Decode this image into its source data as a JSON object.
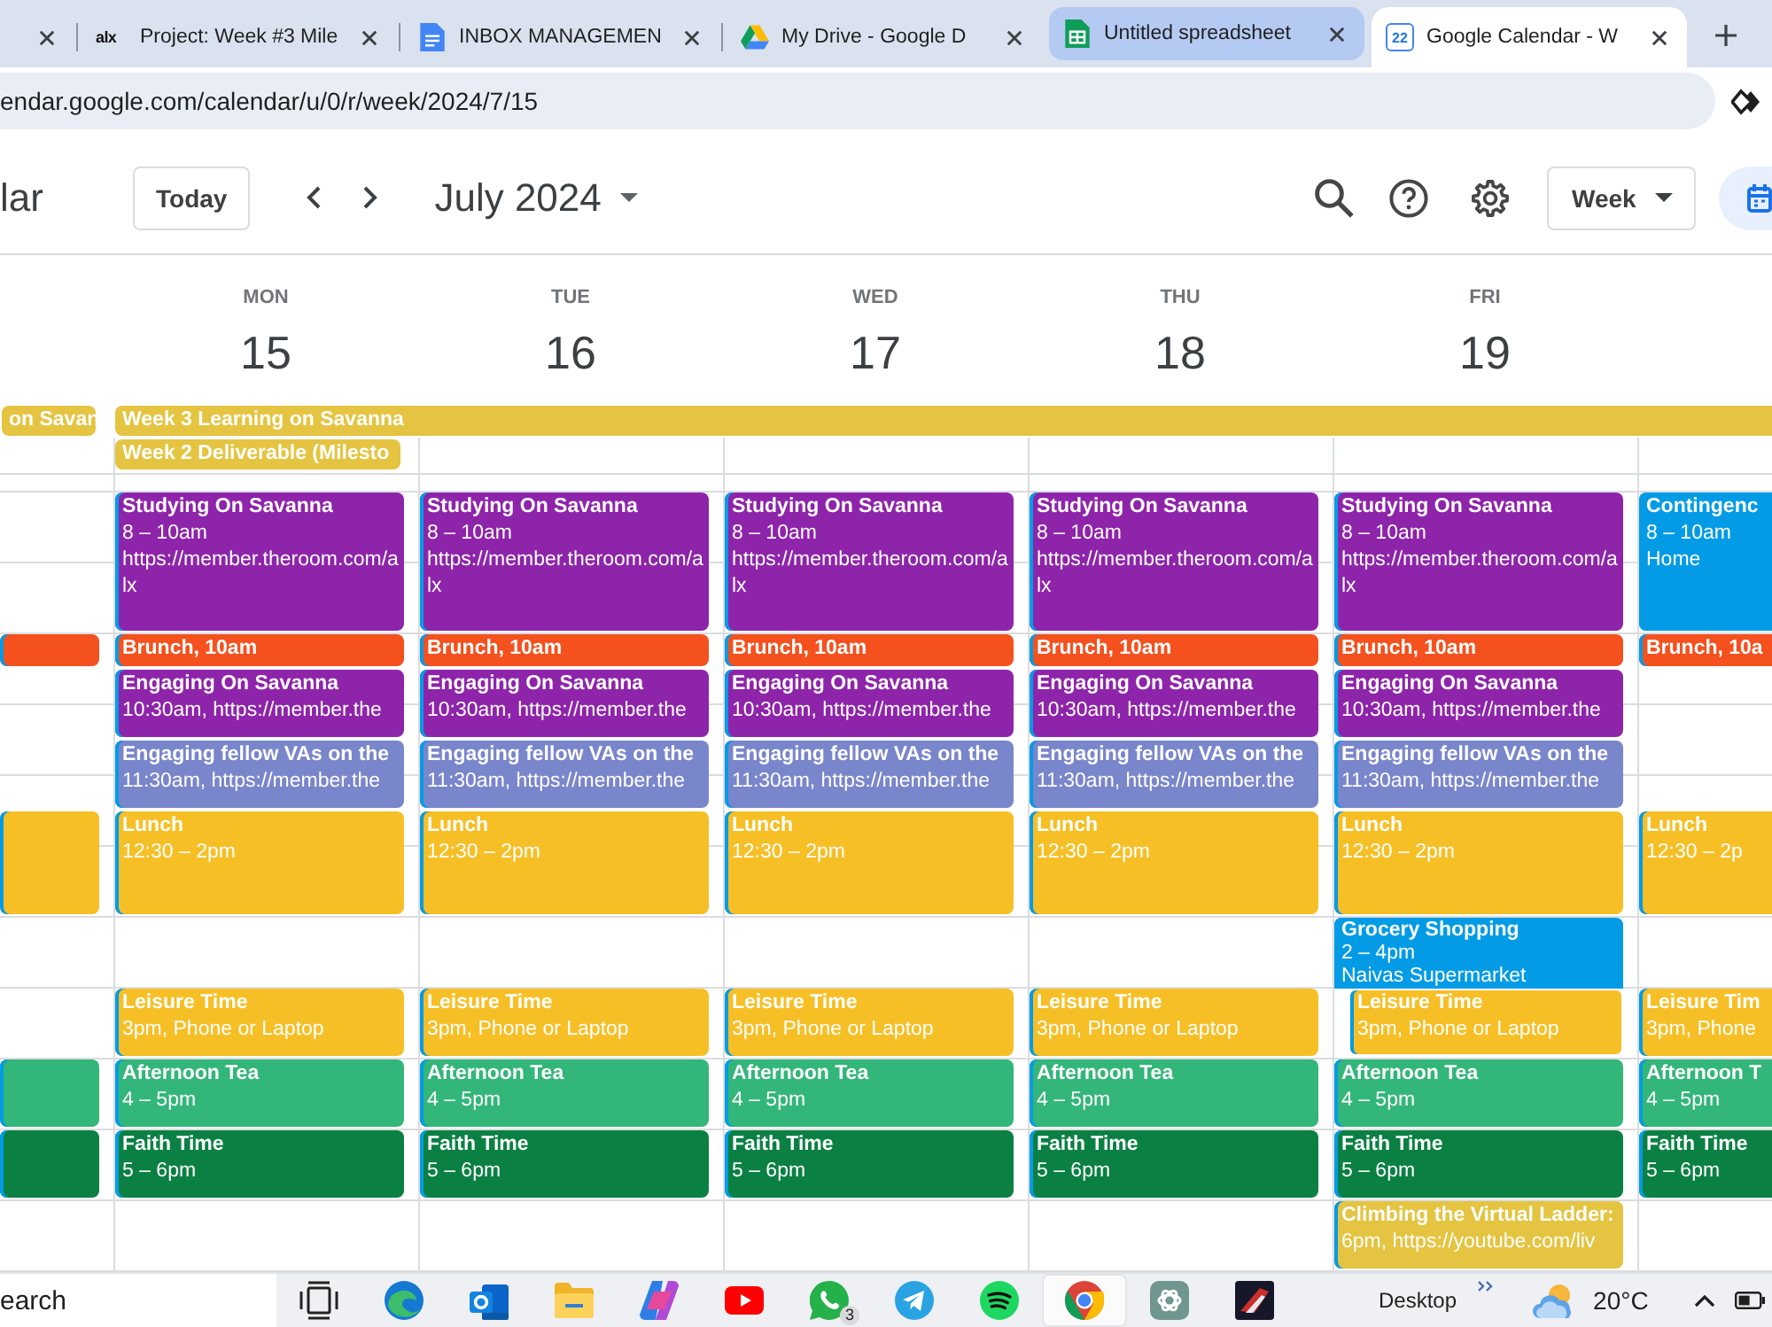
{
  "browser": {
    "tabs": [
      {
        "kind": "blank",
        "selected": false,
        "highlighted": false
      },
      {
        "kind": "alx",
        "icon_text": "alx",
        "title": "Project: Week #3 Mile",
        "selected": false,
        "highlighted": false
      },
      {
        "kind": "docs",
        "title": "INBOX MANAGEMEN",
        "selected": false,
        "highlighted": false
      },
      {
        "kind": "drive",
        "title": "My Drive - Google D",
        "selected": false,
        "highlighted": false
      },
      {
        "kind": "sheets",
        "title": "Untitled spreadsheet",
        "selected": false,
        "highlighted": true
      },
      {
        "kind": "calendar",
        "icon_text": "22",
        "title": "Google Calendar - W",
        "selected": true,
        "highlighted": false
      }
    ],
    "address_bar": {
      "url": "endar.google.com/calendar/u/0/r/week/2024/7/15"
    }
  },
  "header": {
    "app_title": "lar",
    "today_button": "Today",
    "period": "July 2024",
    "view_button": "Week"
  },
  "week": {
    "columns": [
      {
        "all_day": [
          {
            "title": "on Savan",
            "kind": "day",
            "color": "#e4c441"
          }
        ],
        "events": [
          {
            "kind": "free-double"
          },
          {
            "kind": "half",
            "color": "#f4511e"
          },
          {
            "kind": "free-double"
          },
          {
            "kind": "ninety",
            "color": "#f6bf26"
          },
          {
            "kind": "free-double"
          },
          {
            "kind": "hour",
            "color": "#33b679"
          },
          {
            "kind": "hour",
            "color": "#0b8043"
          }
        ]
      },
      {
        "weekday": "MON",
        "date": "15",
        "all_day": [
          {
            "title": "Week 3 Learning on Savanna",
            "kind": "week",
            "color": "#e4c441"
          },
          {
            "title": "Week 2 Deliverable (Milesto",
            "kind": "day",
            "color": "#e4c441"
          }
        ],
        "events": [
          {
            "kind": "double",
            "title": "Studying On Savanna",
            "lines": [
              "8 – 10am",
              "https://member.theroom.com/alx"
            ],
            "color": "#8e24aa"
          },
          {
            "kind": "half",
            "title": "Brunch, 10am",
            "color": "#f4511e"
          },
          {
            "kind": "hour",
            "title": "Engaging On Savanna",
            "lines": [
              "10:30am, https://member.the"
            ],
            "color": "#8e24aa"
          },
          {
            "kind": "hour",
            "title": "Engaging fellow VAs on the",
            "lines": [
              "11:30am, https://member.the"
            ],
            "color": "#7986cb"
          },
          {
            "kind": "ninety",
            "title": "Lunch",
            "lines": [
              "12:30 – 2pm"
            ],
            "color": "#f6bf26"
          },
          {
            "kind": "free-hour"
          },
          {
            "kind": "hour",
            "title": "Leisure Time",
            "lines": [
              "3pm, Phone or Laptop"
            ],
            "color": "#f6bf26"
          },
          {
            "kind": "hour",
            "title": "Afternoon Tea",
            "lines": [
              "4 – 5pm"
            ],
            "color": "#33b679"
          },
          {
            "kind": "hour",
            "title": "Faith Time",
            "lines": [
              "5 – 6pm"
            ],
            "color": "#0b8043"
          }
        ]
      },
      {
        "weekday": "TUE",
        "date": "16",
        "events": [
          {
            "kind": "double",
            "title": "Studying On Savanna",
            "lines": [
              "8 – 10am",
              "https://member.theroom.com/alx"
            ],
            "color": "#8e24aa"
          },
          {
            "kind": "half",
            "title": "Brunch, 10am",
            "color": "#f4511e"
          },
          {
            "kind": "hour",
            "title": "Engaging On Savanna",
            "lines": [
              "10:30am, https://member.the"
            ],
            "color": "#8e24aa"
          },
          {
            "kind": "hour",
            "title": "Engaging fellow VAs on the",
            "lines": [
              "11:30am, https://member.the"
            ],
            "color": "#7986cb"
          },
          {
            "kind": "ninety",
            "title": "Lunch",
            "lines": [
              "12:30 – 2pm"
            ],
            "color": "#f6bf26"
          },
          {
            "kind": "free-hour"
          },
          {
            "kind": "hour",
            "title": "Leisure Time",
            "lines": [
              "3pm, Phone or Laptop"
            ],
            "color": "#f6bf26"
          },
          {
            "kind": "hour",
            "title": "Afternoon Tea",
            "lines": [
              "4 – 5pm"
            ],
            "color": "#33b679"
          },
          {
            "kind": "hour",
            "title": "Faith Time",
            "lines": [
              "5 – 6pm"
            ],
            "color": "#0b8043"
          }
        ]
      },
      {
        "weekday": "WED",
        "date": "17",
        "events": [
          {
            "kind": "double",
            "title": "Studying On Savanna",
            "lines": [
              "8 – 10am",
              "https://member.theroom.com/alx"
            ],
            "color": "#8e24aa"
          },
          {
            "kind": "half",
            "title": "Brunch, 10am",
            "color": "#f4511e"
          },
          {
            "kind": "hour",
            "title": "Engaging On Savanna",
            "lines": [
              "10:30am, https://member.the"
            ],
            "color": "#8e24aa"
          },
          {
            "kind": "hour",
            "title": "Engaging fellow VAs on the",
            "lines": [
              "11:30am, https://member.the"
            ],
            "color": "#7986cb"
          },
          {
            "kind": "ninety",
            "title": "Lunch",
            "lines": [
              "12:30 – 2pm"
            ],
            "color": "#f6bf26"
          },
          {
            "kind": "free-hour"
          },
          {
            "kind": "hour",
            "title": "Leisure Time",
            "lines": [
              "3pm, Phone or Laptop"
            ],
            "color": "#f6bf26"
          },
          {
            "kind": "hour",
            "title": "Afternoon Tea",
            "lines": [
              "4 – 5pm"
            ],
            "color": "#33b679"
          },
          {
            "kind": "hour",
            "title": "Faith Time",
            "lines": [
              "5 – 6pm"
            ],
            "color": "#0b8043"
          }
        ]
      },
      {
        "weekday": "THU",
        "date": "18",
        "events": [
          {
            "kind": "double",
            "title": "Studying On Savanna",
            "lines": [
              "8 – 10am",
              "https://member.theroom.com/alx"
            ],
            "color": "#8e24aa"
          },
          {
            "kind": "half",
            "title": "Brunch, 10am",
            "color": "#f4511e"
          },
          {
            "kind": "hour",
            "title": "Engaging On Savanna",
            "lines": [
              "10:30am, https://member.the"
            ],
            "color": "#8e24aa"
          },
          {
            "kind": "hour",
            "title": "Engaging fellow VAs on the",
            "lines": [
              "11:30am, https://member.the"
            ],
            "color": "#7986cb"
          },
          {
            "kind": "ninety",
            "title": "Lunch",
            "lines": [
              "12:30 – 2pm"
            ],
            "color": "#f6bf26"
          },
          {
            "kind": "free-hour"
          },
          {
            "kind": "hour",
            "title": "Leisure Time",
            "lines": [
              "3pm, Phone or Laptop"
            ],
            "color": "#f6bf26"
          },
          {
            "kind": "hour",
            "title": "Afternoon Tea",
            "lines": [
              "4 – 5pm"
            ],
            "color": "#33b679"
          },
          {
            "kind": "hour",
            "title": "Faith Time",
            "lines": [
              "5 – 6pm"
            ],
            "color": "#0b8043"
          }
        ]
      },
      {
        "weekday": "FRI",
        "date": "19",
        "events": [
          {
            "kind": "double",
            "title": "Studying On Savanna",
            "lines": [
              "8 – 10am",
              "https://member.theroom.com/alx"
            ],
            "color": "#8e24aa"
          },
          {
            "kind": "half",
            "title": "Brunch, 10am",
            "color": "#f4511e"
          },
          {
            "kind": "hour",
            "title": "Engaging On Savanna",
            "lines": [
              "10:30am, https://member.the"
            ],
            "color": "#8e24aa"
          },
          {
            "kind": "hour",
            "title": "Engaging fellow VAs on the",
            "lines": [
              "11:30am, https://member.the"
            ],
            "color": "#7986cb"
          },
          {
            "kind": "ninety",
            "title": "Lunch",
            "lines": [
              "12:30 – 2pm"
            ],
            "color": "#f6bf26"
          },
          {
            "kind": "double",
            "title": "Grocery Shopping",
            "lines": [
              "2 – 4pm",
              "Naivas Supermarket"
            ],
            "color": "#039be5",
            "overlapped_by": {
              "kind": "hour",
              "title": "Leisure Time",
              "lines": [
                "3pm, Phone or Laptop"
              ],
              "color": "#f6bf26"
            }
          },
          {
            "kind": "hour",
            "title": "Afternoon Tea",
            "lines": [
              "4 – 5pm"
            ],
            "color": "#33b679"
          },
          {
            "kind": "hour",
            "title": "Faith Time",
            "lines": [
              "5 – 6pm"
            ],
            "color": "#0b8043"
          },
          {
            "kind": "hour",
            "title": "Climbing the Virtual Ladder:",
            "lines": [
              "6pm, https://youtube.com/liv"
            ],
            "color": "#e4c441"
          }
        ]
      },
      {
        "events": [
          {
            "kind": "double",
            "title": "Contingenc",
            "lines": [
              "8 – 10am",
              "Home"
            ],
            "color": "#039be5"
          },
          {
            "kind": "half",
            "title": "Brunch, 10a",
            "color": "#f4511e"
          },
          {
            "kind": "free-double"
          },
          {
            "kind": "ninety",
            "title": "Lunch",
            "lines": [
              "12:30 – 2p"
            ],
            "color": "#f6bf26"
          },
          {
            "kind": "free-hour"
          },
          {
            "kind": "hour",
            "title": "Leisure Tim",
            "lines": [
              "3pm, Phone"
            ],
            "color": "#f6bf26"
          },
          {
            "kind": "hour",
            "title": "Afternoon T",
            "lines": [
              "4 – 5pm"
            ],
            "color": "#33b679"
          },
          {
            "kind": "hour",
            "title": "Faith Time",
            "lines": [
              "5 – 6pm"
            ],
            "color": "#0b8043"
          }
        ]
      }
    ]
  },
  "taskbar": {
    "search": {
      "placeholder": "earch"
    },
    "apps": [
      {
        "kind": "task-view",
        "selected": false
      },
      {
        "kind": "edge",
        "selected": false
      },
      {
        "kind": "outlook",
        "selected": false
      },
      {
        "kind": "files",
        "selected": false
      },
      {
        "kind": "copilot",
        "selected": false
      },
      {
        "kind": "youtube",
        "selected": false
      },
      {
        "kind": "whatsapp",
        "badge": "3",
        "selected": false
      },
      {
        "kind": "telegram",
        "selected": false
      },
      {
        "kind": "spotify",
        "selected": false
      },
      {
        "kind": "chrome",
        "selected": true
      },
      {
        "kind": "chatgpt",
        "selected": false
      },
      {
        "kind": "game",
        "selected": false
      }
    ],
    "desktop_label": "Desktop",
    "temperature": "20°C"
  }
}
